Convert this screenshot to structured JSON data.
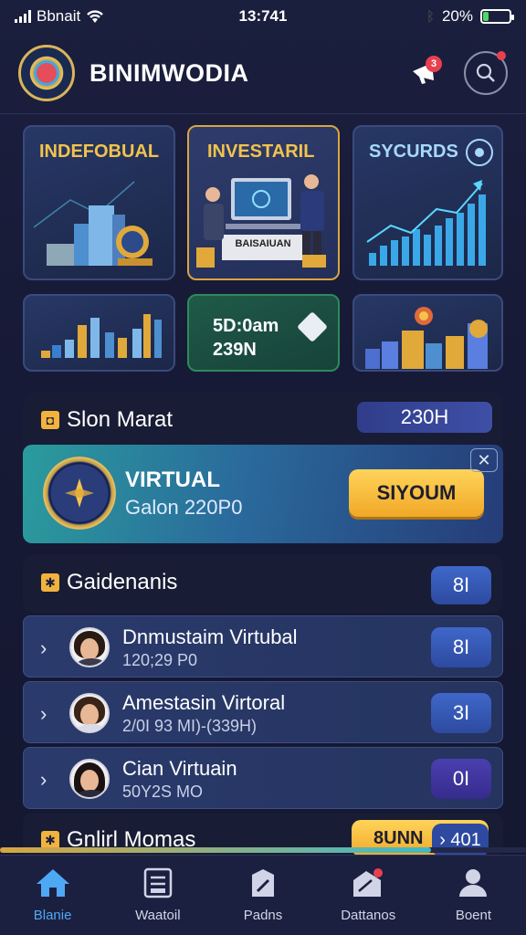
{
  "status": {
    "carrier": "Bbnait",
    "time": "13:741",
    "battery": "20%",
    "battery_level": 0.2
  },
  "header": {
    "title": "BINIMWODIA",
    "notification_count": "3"
  },
  "cards": {
    "c1_title": "INDEFOBUAL",
    "c2_title": "INVESTARIL",
    "c2_sign": "BAISAIUAN",
    "c3_title": "SYCURDS",
    "c5_line1": "5D:0am",
    "c5_line2": "239N"
  },
  "slot": {
    "title": "Slon Marat",
    "value": "230H",
    "banner_title": "VIRTUAL",
    "banner_sub": "Galon 220P0",
    "banner_button": "SIYOUM",
    "close": "✕"
  },
  "gardens": {
    "title": "Gaidenanis",
    "value": "8I",
    "rows": [
      {
        "title": "Dnmustaim Virtubal",
        "sub": "120;29 P0",
        "value": "8I"
      },
      {
        "title": "Amestasin Virtoral",
        "sub": "2/0I 93 MI)-(339H)",
        "value": "3I"
      },
      {
        "title": "Cian Virtuain",
        "sub": "50Y2S MO",
        "value": "0I"
      }
    ]
  },
  "bottom_section": {
    "title": "Gnlirl Momas",
    "gold_label": "8UNN",
    "badge": "401",
    "progress": 0.82
  },
  "nav": [
    "Blanie",
    "Waatoil",
    "Padns",
    "Dattanos",
    "Boent"
  ],
  "colors": {
    "accent_gold": "#f3c34b",
    "accent_blue": "#4ea9f5",
    "badge_red": "#e8404f"
  }
}
